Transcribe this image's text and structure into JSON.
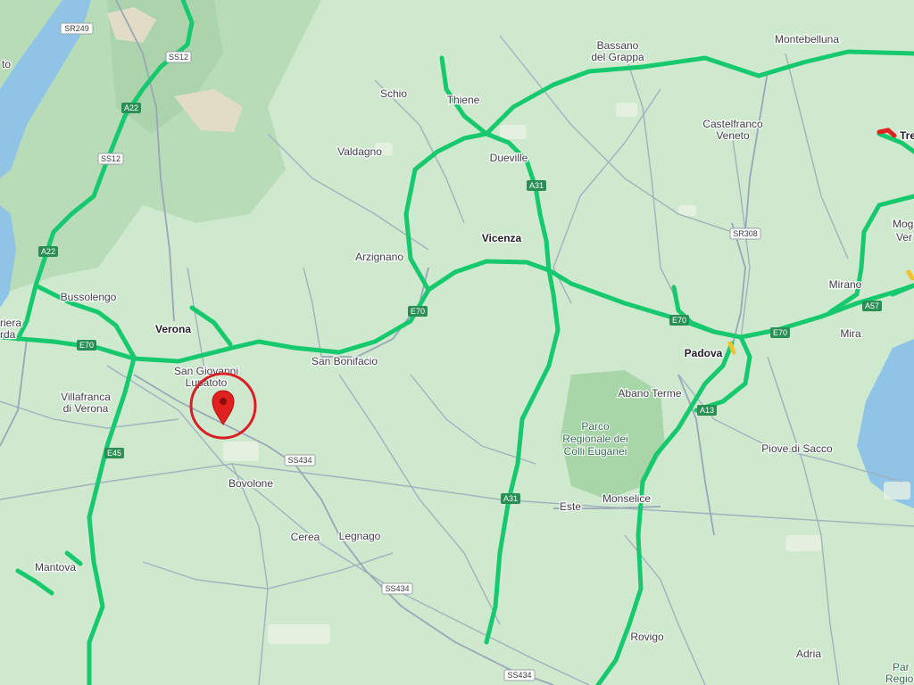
{
  "map": {
    "cities": [
      {
        "id": "bassano-1",
        "text": "Bassano"
      },
      {
        "id": "bassano-2",
        "text": "del Grappa"
      },
      {
        "id": "montebelluna",
        "text": "Montebelluna"
      },
      {
        "id": "schio",
        "text": "Schio"
      },
      {
        "id": "thiene",
        "text": "Thiene"
      },
      {
        "id": "castelfranco-1",
        "text": "Castelfranco"
      },
      {
        "id": "castelfranco-2",
        "text": "Veneto"
      },
      {
        "id": "valdagno",
        "text": "Valdagno"
      },
      {
        "id": "dueville",
        "text": "Dueville"
      },
      {
        "id": "vicenza",
        "text": "Vicenza"
      },
      {
        "id": "arzignano",
        "text": "Arzignano"
      },
      {
        "id": "bussolengo",
        "text": "Bussolengo"
      },
      {
        "id": "verona",
        "text": "Verona"
      },
      {
        "id": "san-bonifacio",
        "text": "San Bonifacio"
      },
      {
        "id": "san-giovanni-1",
        "text": "San Giovanni"
      },
      {
        "id": "san-giovanni-2",
        "text": "Lupatoto"
      },
      {
        "id": "villafranca-1",
        "text": "Villafranca"
      },
      {
        "id": "villafranca-2",
        "text": "di Verona"
      },
      {
        "id": "padova",
        "text": "Padova"
      },
      {
        "id": "abano",
        "text": "Abano Terme"
      },
      {
        "id": "mirano",
        "text": "Mirano"
      },
      {
        "id": "mira",
        "text": "Mira"
      },
      {
        "id": "piove",
        "text": "Piove di Sacco"
      },
      {
        "id": "bovolone",
        "text": "Bovolone"
      },
      {
        "id": "cerea",
        "text": "Cerea"
      },
      {
        "id": "legnago",
        "text": "Legnago"
      },
      {
        "id": "este",
        "text": "Este"
      },
      {
        "id": "monselice",
        "text": "Monselice"
      },
      {
        "id": "mantova",
        "text": "Mantova"
      },
      {
        "id": "rovigo",
        "text": "Rovigo"
      },
      {
        "id": "adria",
        "text": "Adria"
      },
      {
        "id": "treviso-cut",
        "text": "Tre"
      },
      {
        "id": "mog-cut",
        "text": "Mog"
      },
      {
        "id": "ven-cut",
        "text": "Ver"
      },
      {
        "id": "riera-cut",
        "text": "riera"
      },
      {
        "id": "garda-cut",
        "text": "rda"
      },
      {
        "id": "to-cut",
        "text": "to"
      },
      {
        "id": "parco-cut-1",
        "text": "Par"
      },
      {
        "id": "parco-cut-2",
        "text": "Regio"
      }
    ],
    "park": [
      "Parco",
      "Regionale dei",
      "Colli Euganei"
    ],
    "shields": [
      {
        "id": "sr249",
        "text": "SR249",
        "type": "gray"
      },
      {
        "id": "ss12-a",
        "text": "SS12",
        "type": "gray"
      },
      {
        "id": "a22-a",
        "text": "A22",
        "type": "green"
      },
      {
        "id": "ss12-b",
        "text": "SS12",
        "type": "gray"
      },
      {
        "id": "a22-b",
        "text": "A22",
        "type": "green"
      },
      {
        "id": "e70-a",
        "text": "E70",
        "type": "green"
      },
      {
        "id": "e70-b",
        "text": "E70",
        "type": "green"
      },
      {
        "id": "a31-a",
        "text": "A31",
        "type": "green"
      },
      {
        "id": "sr308",
        "text": "SR308",
        "type": "gray"
      },
      {
        "id": "e70-c",
        "text": "E70",
        "type": "green"
      },
      {
        "id": "e70-d",
        "text": "E70",
        "type": "green"
      },
      {
        "id": "a57",
        "text": "A57",
        "type": "green"
      },
      {
        "id": "a13",
        "text": "A13",
        "type": "green"
      },
      {
        "id": "e45",
        "text": "E45",
        "type": "green"
      },
      {
        "id": "ss434-a",
        "text": "SS434",
        "type": "gray"
      },
      {
        "id": "a31-b",
        "text": "A31",
        "type": "green"
      },
      {
        "id": "ss434-b",
        "text": "SS434",
        "type": "gray"
      },
      {
        "id": "ss434-c",
        "text": "SS434",
        "type": "gray"
      }
    ],
    "colors": {
      "land": "#cfe9cf",
      "water": "#8fc4e6",
      "traffic_green": "#16c96e",
      "marker_red": "#e0211f",
      "circle_red": "#d81f26"
    },
    "marker": {
      "icon": "map-pin-icon"
    }
  }
}
